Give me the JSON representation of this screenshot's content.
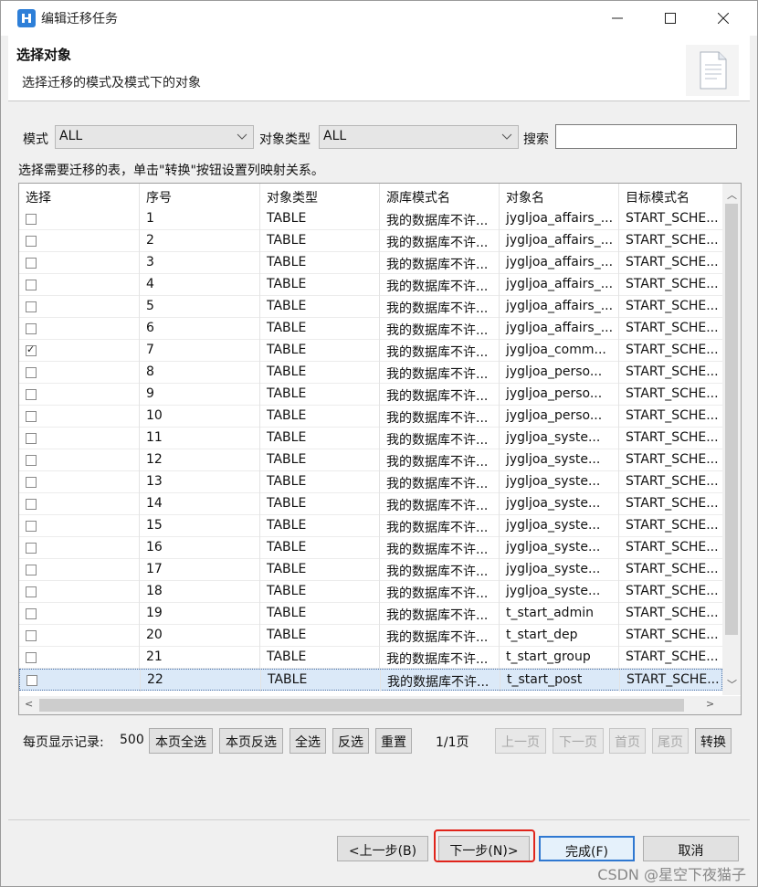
{
  "window": {
    "title": "编辑迁移任务"
  },
  "header": {
    "title": "选择对象",
    "subtitle": "选择迁移的模式及模式下的对象"
  },
  "filters": {
    "mode_label": "模式",
    "mode_value": "ALL",
    "type_label": "对象类型",
    "type_value": "ALL",
    "search_label": "搜索",
    "search_value": ""
  },
  "hint": "选择需要迁移的表，单击\"转换\"按钮设置列映射关系。",
  "table": {
    "columns": [
      "选择",
      "序号",
      "对象类型",
      "源库模式名",
      "对象名",
      "目标模式名"
    ],
    "rows": [
      {
        "checked": false,
        "num": "1",
        "type": "TABLE",
        "src": "我的数据库不许...",
        "obj": "jygljoa_affairs_...",
        "dst": "START_SCHE..."
      },
      {
        "checked": false,
        "num": "2",
        "type": "TABLE",
        "src": "我的数据库不许...",
        "obj": "jygljoa_affairs_...",
        "dst": "START_SCHE..."
      },
      {
        "checked": false,
        "num": "3",
        "type": "TABLE",
        "src": "我的数据库不许...",
        "obj": "jygljoa_affairs_...",
        "dst": "START_SCHE..."
      },
      {
        "checked": false,
        "num": "4",
        "type": "TABLE",
        "src": "我的数据库不许...",
        "obj": "jygljoa_affairs_...",
        "dst": "START_SCHE..."
      },
      {
        "checked": false,
        "num": "5",
        "type": "TABLE",
        "src": "我的数据库不许...",
        "obj": "jygljoa_affairs_...",
        "dst": "START_SCHE..."
      },
      {
        "checked": false,
        "num": "6",
        "type": "TABLE",
        "src": "我的数据库不许...",
        "obj": "jygljoa_affairs_...",
        "dst": "START_SCHE..."
      },
      {
        "checked": true,
        "num": "7",
        "type": "TABLE",
        "src": "我的数据库不许...",
        "obj": "jygljoa_comm...",
        "dst": "START_SCHE..."
      },
      {
        "checked": false,
        "num": "8",
        "type": "TABLE",
        "src": "我的数据库不许...",
        "obj": "jygljoa_perso...",
        "dst": "START_SCHE..."
      },
      {
        "checked": false,
        "num": "9",
        "type": "TABLE",
        "src": "我的数据库不许...",
        "obj": "jygljoa_perso...",
        "dst": "START_SCHE..."
      },
      {
        "checked": false,
        "num": "10",
        "type": "TABLE",
        "src": "我的数据库不许...",
        "obj": "jygljoa_perso...",
        "dst": "START_SCHE..."
      },
      {
        "checked": false,
        "num": "11",
        "type": "TABLE",
        "src": "我的数据库不许...",
        "obj": "jygljoa_syste...",
        "dst": "START_SCHE..."
      },
      {
        "checked": false,
        "num": "12",
        "type": "TABLE",
        "src": "我的数据库不许...",
        "obj": "jygljoa_syste...",
        "dst": "START_SCHE..."
      },
      {
        "checked": false,
        "num": "13",
        "type": "TABLE",
        "src": "我的数据库不许...",
        "obj": "jygljoa_syste...",
        "dst": "START_SCHE..."
      },
      {
        "checked": false,
        "num": "14",
        "type": "TABLE",
        "src": "我的数据库不许...",
        "obj": "jygljoa_syste...",
        "dst": "START_SCHE..."
      },
      {
        "checked": false,
        "num": "15",
        "type": "TABLE",
        "src": "我的数据库不许...",
        "obj": "jygljoa_syste...",
        "dst": "START_SCHE..."
      },
      {
        "checked": false,
        "num": "16",
        "type": "TABLE",
        "src": "我的数据库不许...",
        "obj": "jygljoa_syste...",
        "dst": "START_SCHE..."
      },
      {
        "checked": false,
        "num": "17",
        "type": "TABLE",
        "src": "我的数据库不许...",
        "obj": "jygljoa_syste...",
        "dst": "START_SCHE..."
      },
      {
        "checked": false,
        "num": "18",
        "type": "TABLE",
        "src": "我的数据库不许...",
        "obj": "jygljoa_syste...",
        "dst": "START_SCHE..."
      },
      {
        "checked": false,
        "num": "19",
        "type": "TABLE",
        "src": "我的数据库不许...",
        "obj": "t_start_admin",
        "dst": "START_SCHE..."
      },
      {
        "checked": false,
        "num": "20",
        "type": "TABLE",
        "src": "我的数据库不许...",
        "obj": "t_start_dep",
        "dst": "START_SCHE..."
      },
      {
        "checked": false,
        "num": "21",
        "type": "TABLE",
        "src": "我的数据库不许...",
        "obj": "t_start_group",
        "dst": "START_SCHE..."
      },
      {
        "checked": false,
        "num": "22",
        "type": "TABLE",
        "src": "我的数据库不许...",
        "obj": "t_start_post",
        "dst": "START_SCHE..."
      }
    ]
  },
  "paging": {
    "per_page_label": "每页显示记录:",
    "per_page_value": "500",
    "select_page": "本页全选",
    "invert_page": "本页反选",
    "select_all": "全选",
    "invert": "反选",
    "reset": "重置",
    "page_info": "1/1页",
    "prev": "上一页",
    "next": "下一页",
    "first": "首页",
    "last": "尾页",
    "convert": "转换"
  },
  "buttons": {
    "back": "<上一步(B)",
    "next": "下一步(N)>",
    "finish": "完成(F)",
    "cancel": "取消"
  },
  "watermark": "CSDN @星空下夜猫子",
  "colors": {
    "highlight": "#e0241b",
    "selected_row": "#dbe9f8",
    "default_button_border": "#2f78d1"
  }
}
